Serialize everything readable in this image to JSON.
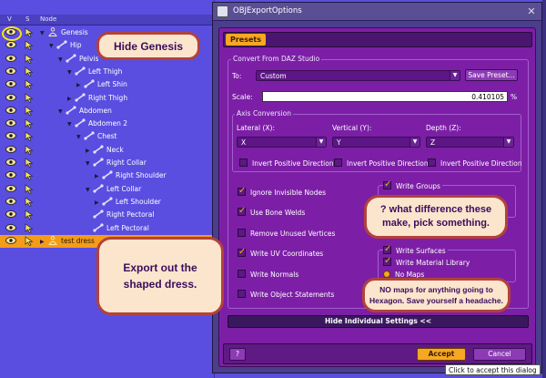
{
  "scene": {
    "header": {
      "col_visibility": "V",
      "col_select": "S",
      "col_node": "Node"
    },
    "rows": [
      {
        "label": "Genesis",
        "indent": 0,
        "icon": "figure-icon",
        "expand": "open"
      },
      {
        "label": "Hip",
        "indent": 1,
        "icon": "bone-icon",
        "expand": "open"
      },
      {
        "label": "Pelvis",
        "indent": 2,
        "icon": "bone-icon",
        "expand": "open"
      },
      {
        "label": "Left Thigh",
        "indent": 3,
        "icon": "bone-icon",
        "expand": "open"
      },
      {
        "label": "Left Shin",
        "indent": 4,
        "icon": "bone-icon",
        "expand": "closed"
      },
      {
        "label": "Right Thigh",
        "indent": 3,
        "icon": "bone-icon",
        "expand": "closed"
      },
      {
        "label": "Abdomen",
        "indent": 2,
        "icon": "bone-icon",
        "expand": "open"
      },
      {
        "label": "Abdomen 2",
        "indent": 3,
        "icon": "bone-icon",
        "expand": "open"
      },
      {
        "label": "Chest",
        "indent": 4,
        "icon": "bone-icon",
        "expand": "open"
      },
      {
        "label": "Neck",
        "indent": 5,
        "icon": "bone-icon",
        "expand": "closed"
      },
      {
        "label": "Right Collar",
        "indent": 5,
        "icon": "bone-icon",
        "expand": "open"
      },
      {
        "label": "Right Shoulder",
        "indent": 6,
        "icon": "bone-icon",
        "expand": "closed"
      },
      {
        "label": "Left Collar",
        "indent": 5,
        "icon": "bone-icon",
        "expand": "open"
      },
      {
        "label": "Left Shoulder",
        "indent": 6,
        "icon": "bone-icon",
        "expand": "closed"
      },
      {
        "label": "Right Pectoral",
        "indent": 5,
        "icon": "bone-icon",
        "expand": "none"
      },
      {
        "label": "Left Pectoral",
        "indent": 5,
        "icon": "bone-icon",
        "expand": "none"
      },
      {
        "label": "test dress",
        "indent": 0,
        "icon": "figure-icon",
        "expand": "closed",
        "selected": true
      }
    ]
  },
  "dialog": {
    "title": "OBJExportOptions",
    "presets_tab": "Presets",
    "convert_group": "Convert From DAZ Studio",
    "to_label": "To:",
    "to_value": "Custom",
    "save_preset": "Save Preset...",
    "scale_label": "Scale:",
    "scale_value": "0.410105",
    "scale_unit": "%",
    "axis_group": "Axis Conversion",
    "lateral_label": "Lateral (X):",
    "vertical_label": "Vertical (Y):",
    "depth_label": "Depth (Z):",
    "lateral_value": "X",
    "vertical_value": "Y",
    "depth_value": "Z",
    "invert_label": "Invert Positive Direction",
    "ignore_invisible": "Ignore Invisible Nodes",
    "use_bone_welds": "Use Bone Welds",
    "remove_unused": "Remove Unused Vertices",
    "write_uv": "Write UV Coordinates",
    "write_normals": "Write Normals",
    "write_object_statements": "Write Object Statements",
    "write_groups": "Write Groups",
    "write_surfaces": "Write Surfaces",
    "write_material_library": "Write Material Library",
    "no_maps": "No Maps",
    "hide_individual": "Hide Individual Settings <<",
    "help": "?",
    "accept": "Accept",
    "cancel": "Cancel",
    "tooltip": "Click to accept this dialog"
  },
  "callouts": {
    "hide_genesis": "Hide Genesis",
    "export_dress": "Export out the shaped dress.",
    "groups_note": "? what difference these make, pick something.",
    "maps_note": "NO maps for anything going to Hexagon. Save yourself a headache."
  },
  "colors": {
    "dialog_purple": "#7c1fa6",
    "accent_orange": "#f7a722",
    "scene_blue": "#5a4ee0",
    "callout_fill": "#fbe5cd",
    "callout_border": "#b2423a"
  }
}
